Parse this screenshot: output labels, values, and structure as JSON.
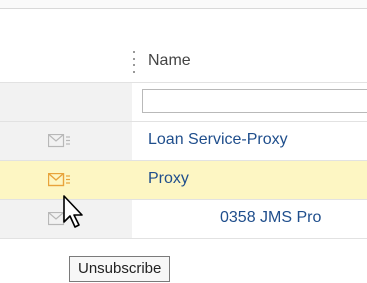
{
  "table": {
    "column_header": "Name",
    "filter": {
      "value": "",
      "placeholder": ""
    },
    "rows": [
      {
        "name": "Loan Service-Proxy",
        "icon": "mail-subscribe-icon",
        "highlighted": false
      },
      {
        "name": "Proxy",
        "icon": "mail-subscribe-icon",
        "highlighted": true
      },
      {
        "name": "0358 JMS Pro",
        "icon": "mail-subscribe-icon",
        "highlighted": false
      }
    ]
  },
  "tooltip": {
    "text": "Unsubscribe"
  },
  "colors": {
    "highlight_row": "#fdf6c3",
    "icon_active": "#e8a33b",
    "icon_inactive": "#b8b8b8",
    "link_text": "#1f4e8c"
  }
}
